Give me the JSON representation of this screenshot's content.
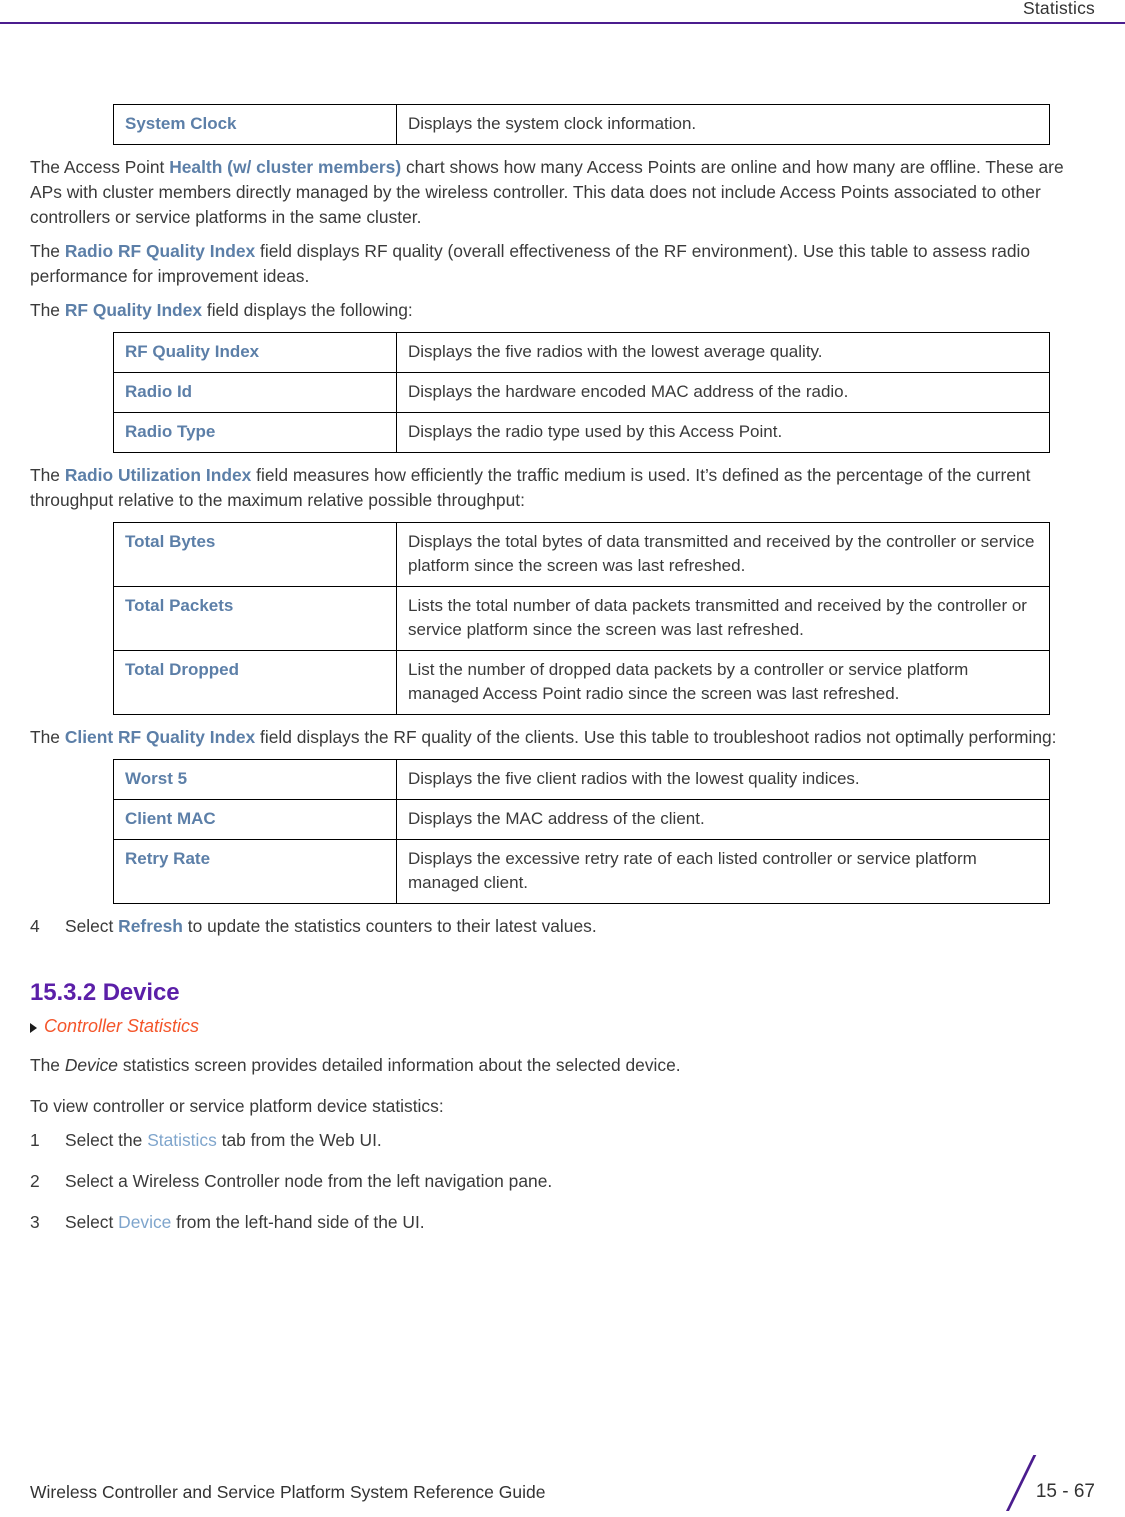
{
  "header": {
    "title": "Statistics",
    "rule_color": "#4B1D8E"
  },
  "colors": {
    "term_blue": "#5C7FA8",
    "link_light_blue": "#7FA5CC",
    "heading_purple": "#5B1FA8",
    "xref_orange": "#F4552A",
    "body_text": "#3a3a3a"
  },
  "tables": {
    "system_clock": {
      "rows": [
        {
          "label": "System Clock",
          "description": "Displays the system clock information."
        }
      ]
    },
    "rf_quality_index": {
      "rows": [
        {
          "label": "RF Quality Index",
          "description": "Displays the five radios with the lowest average quality."
        },
        {
          "label": "Radio Id",
          "description": "Displays the hardware encoded MAC address of the radio."
        },
        {
          "label": "Radio Type",
          "description": "Displays the radio type used by this Access Point."
        }
      ]
    },
    "radio_utilization_index": {
      "rows": [
        {
          "label": "Total Bytes",
          "description": "Displays the total bytes of data transmitted and received by the controller or service platform since the screen was last refreshed."
        },
        {
          "label": "Total Packets",
          "description": "Lists the total number of data packets transmitted and received by the controller or service platform since the screen was last refreshed."
        },
        {
          "label": "Total Dropped",
          "description": "List the number of dropped data packets by a controller or service platform managed Access Point radio since the screen was last refreshed."
        }
      ]
    },
    "client_rf_quality_index": {
      "rows": [
        {
          "label": "Worst 5",
          "description": "Displays the five client radios with the lowest quality indices."
        },
        {
          "label": "Client MAC",
          "description": "Displays the MAC address of the client."
        },
        {
          "label": "Retry Rate",
          "description": "Displays the excessive retry rate of each listed controller or service platform managed client."
        }
      ]
    }
  },
  "paragraphs": {
    "ap_health": {
      "pre": "The Access Point ",
      "term": "Health (w/ cluster members)",
      "post": " chart shows how many Access Points are online and how many are offline. These are APs with cluster members directly managed by the wireless controller. This data does not include Access Points associated to other controllers or service platforms in the same cluster."
    },
    "radio_rf_quality": {
      "pre": "The ",
      "term": "Radio RF Quality Index",
      "post": " field displays RF quality (overall effectiveness of the RF environment). Use this table to assess radio performance for improvement ideas."
    },
    "rf_quality_intro": {
      "pre": "The ",
      "term": "RF Quality Index",
      "post": " field displays the following:"
    },
    "radio_utilization": {
      "pre": "The ",
      "term": "Radio Utilization Index",
      "post": " field measures how efficiently the traffic medium is used. It’s defined as the percentage of the current throughput relative to the maximum relative possible throughput:"
    },
    "client_rf_quality": {
      "pre": "The ",
      "term": "Client RF Quality Index",
      "post": " field displays the RF quality of the clients. Use this table to troubleshoot radios not optimally performing:"
    },
    "device_intro": {
      "pre": "The ",
      "italic": "Device",
      "post": " statistics screen provides detailed information about the selected device."
    },
    "view_intro": "To view controller or service platform device statistics:"
  },
  "step4": {
    "num": "4",
    "pre": "Select ",
    "term": "Refresh",
    "post": " to update the statistics counters to their latest values."
  },
  "section": {
    "heading": "15.3.2 Device",
    "xref": "Controller Statistics"
  },
  "steps": [
    {
      "num": "1",
      "pre": "Select the ",
      "link": "Statistics",
      "post": " tab from the Web UI."
    },
    {
      "num": "2",
      "pre": "Select a Wireless Controller node from the left navigation pane.",
      "link": "",
      "post": ""
    },
    {
      "num": "3",
      "pre": "Select ",
      "link": "Device",
      "post": " from the left-hand side of the UI."
    }
  ],
  "footer": {
    "title": "Wireless Controller and Service Platform System Reference Guide",
    "page_number": "15 - 67"
  }
}
